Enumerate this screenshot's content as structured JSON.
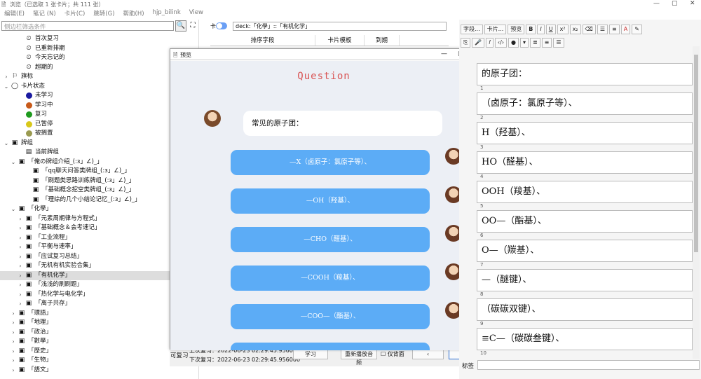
{
  "window": {
    "title": "浏览（已选取 1 张卡片；共 111 张）",
    "minimize": "—",
    "maximize": "▢",
    "close": "✕"
  },
  "menu": [
    "编辑(E)",
    "笔记 (N)",
    "卡片(C)",
    "跳转(G)",
    "帮助(H)",
    "hjp_bilink",
    "View"
  ],
  "filter": {
    "placeholder": "侧边栏筛选条件",
    "search_icon": "🔍",
    "frame_icon": "⛶"
  },
  "tree": [
    {
      "l": 2,
      "arrow": "",
      "icon": "⏲",
      "label": "首次复习"
    },
    {
      "l": 2,
      "arrow": "",
      "icon": "⏲",
      "label": "已重新排期"
    },
    {
      "l": 2,
      "arrow": "",
      "icon": "⏲",
      "label": "今天忘记的"
    },
    {
      "l": 2,
      "arrow": "",
      "icon": "⏲",
      "label": "超期的"
    },
    {
      "l": 0,
      "arrow": "›",
      "icon": "⚐",
      "label": "旗标"
    },
    {
      "l": 0,
      "arrow": "⌄",
      "icon": "◯",
      "label": "卡片状态"
    },
    {
      "l": 2,
      "arrow": "",
      "dot": "#1a1aa0",
      "label": "未学习"
    },
    {
      "l": 2,
      "arrow": "",
      "dot": "#c85a1a",
      "label": "学习中"
    },
    {
      "l": 2,
      "arrow": "",
      "dot": "#1e9a1e",
      "label": "复习"
    },
    {
      "l": 2,
      "arrow": "",
      "dot": "#d8c81a",
      "label": "已暂停"
    },
    {
      "l": 2,
      "arrow": "",
      "dot": "#9a9a50",
      "label": "被搁置"
    },
    {
      "l": 0,
      "arrow": "⌄",
      "icon": "▣",
      "label": "牌组"
    },
    {
      "l": 2,
      "arrow": "",
      "icon": "▤",
      "label": "当前牌组"
    },
    {
      "l": 1,
      "arrow": "⌄",
      "icon": "▣",
      "label": "「俺の牌组介绍_(:з」∠)_」"
    },
    {
      "l": 3,
      "arrow": "",
      "icon": "▣",
      "label": "「qq聊天问答类牌组_(:з」∠)_」"
    },
    {
      "l": 3,
      "arrow": "",
      "icon": "▣",
      "label": "「刷题类思路训练牌组_(:з」∠)_」"
    },
    {
      "l": 3,
      "arrow": "",
      "icon": "▣",
      "label": "「基础概念挖空类牌组_(:з」∠)_」"
    },
    {
      "l": 3,
      "arrow": "",
      "icon": "▣",
      "label": "「理综的几个小结论记忆_(:з」∠)_」"
    },
    {
      "l": 1,
      "arrow": "⌄",
      "icon": "▣",
      "label": "「化學」"
    },
    {
      "l": 2,
      "arrow": "›",
      "icon": "▣",
      "label": "「元素周期律与方程式」"
    },
    {
      "l": 2,
      "arrow": "›",
      "icon": "▣",
      "label": "「基础概念＆会考速记」"
    },
    {
      "l": 2,
      "arrow": "›",
      "icon": "▣",
      "label": "「工业流程」"
    },
    {
      "l": 2,
      "arrow": "›",
      "icon": "▣",
      "label": "「平衡与速率」"
    },
    {
      "l": 2,
      "arrow": "›",
      "icon": "▣",
      "label": "「应试复习总结」"
    },
    {
      "l": 2,
      "arrow": "›",
      "icon": "▣",
      "label": "「无机有机实验合集」"
    },
    {
      "l": 2,
      "arrow": "›",
      "icon": "▣",
      "label": "「有机化学」",
      "sel": true
    },
    {
      "l": 2,
      "arrow": "›",
      "icon": "▣",
      "label": "「浅浅的刷刷题」"
    },
    {
      "l": 2,
      "arrow": "›",
      "icon": "▣",
      "label": "「热化学与电化学」"
    },
    {
      "l": 2,
      "arrow": "›",
      "icon": "▣",
      "label": "「离子共存」"
    },
    {
      "l": 1,
      "arrow": "›",
      "icon": "▣",
      "label": "「環語」"
    },
    {
      "l": 1,
      "arrow": "›",
      "icon": "▣",
      "label": "「地理」"
    },
    {
      "l": 1,
      "arrow": "›",
      "icon": "▣",
      "label": "「政治」"
    },
    {
      "l": 1,
      "arrow": "›",
      "icon": "▣",
      "label": "「數學」"
    },
    {
      "l": 1,
      "arrow": "›",
      "icon": "▣",
      "label": "「歷史」"
    },
    {
      "l": 1,
      "arrow": "›",
      "icon": "▣",
      "label": "「生物」"
    },
    {
      "l": 1,
      "arrow": "›",
      "icon": "▣",
      "label": "「語文」"
    }
  ],
  "center": {
    "toggle_label": "卡",
    "deck_query": "deck:「化學」::「有机化学」",
    "columns": [
      "排序字段",
      "卡片模板",
      "到期"
    ]
  },
  "preview": {
    "title": "预览",
    "minimize": "—",
    "maximize": "▢",
    "close": "✕",
    "question_title": "Question",
    "question": "常见的原子团：",
    "answers": [
      "—X（卤原子：氯原子等）、",
      "—OH（羟基）、",
      "—CHO（醛基）、",
      "—COOH（羧基）、",
      "—COO—（酯基）、"
    ],
    "footer_left": "可复习",
    "last_review": "上次复习：2022-06-23 02:29:45.956000",
    "next_review": "下次复习：2022-06-23 02:29:45.956000",
    "btn_study": "学习",
    "btn_replay": "重新播放音频",
    "back_only": "仅背面",
    "prev": "‹",
    "next": "›"
  },
  "editor": {
    "buttons": [
      "字段...",
      "卡片...",
      "预览"
    ],
    "fields": [
      {
        "n": "",
        "t": "的原子团："
      },
      {
        "n": "1",
        "t": "（卤原子：氯原子等）、"
      },
      {
        "n": "2",
        "t": "H（羟基）、"
      },
      {
        "n": "3",
        "t": "HO（醛基）、"
      },
      {
        "n": "4",
        "t": "OOH（羧基）、"
      },
      {
        "n": "5",
        "t": "OO—（酯基）、"
      },
      {
        "n": "6",
        "t": "O—（羰基）、"
      },
      {
        "n": "7",
        "t": "—（醚键）、"
      },
      {
        "n": "8",
        "t": "（碳碳双键）、"
      },
      {
        "n": "9",
        "t": "≡C—（碳碳叁键）、"
      },
      {
        "n": "10",
        "t": ""
      }
    ],
    "tags_label": "标签"
  }
}
